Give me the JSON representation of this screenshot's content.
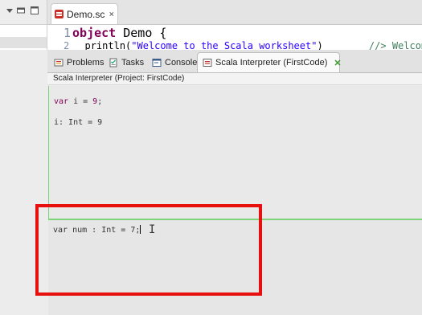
{
  "editor": {
    "tab_label": "Demo.sc",
    "line1_number": "1",
    "line1_keyword": "object",
    "line1_rest": " Demo {",
    "line2_number": "2",
    "line2_text": "println(",
    "line2_string": "\"Welcome to the Scala worksheet\"",
    "line2_close": ")",
    "line2_comment": "//> Welcome"
  },
  "views": {
    "tabs": [
      {
        "label": "Problems",
        "icon": "problems-icon"
      },
      {
        "label": "Tasks",
        "icon": "tasks-icon"
      },
      {
        "label": "Console",
        "icon": "console-icon"
      },
      {
        "label": "Scala Interpreter (FirstCode)",
        "icon": "scala-interpreter-icon",
        "active": true
      }
    ],
    "close_glyph": "✕"
  },
  "interpreter": {
    "header": "Scala Interpreter (Project: FirstCode)",
    "output": [
      {
        "keyword": "var",
        "text": " i = ",
        "value": "9",
        "suffix": ";"
      },
      {
        "text": "i: Int = 9"
      }
    ],
    "input_keyword": "var",
    "input_text": " num : Int = 7;",
    "cursor_glyph": "I"
  },
  "colors": {
    "highlight": "#e8100f",
    "pane_border": "#7ed27a",
    "keyword": "#7f0055"
  }
}
